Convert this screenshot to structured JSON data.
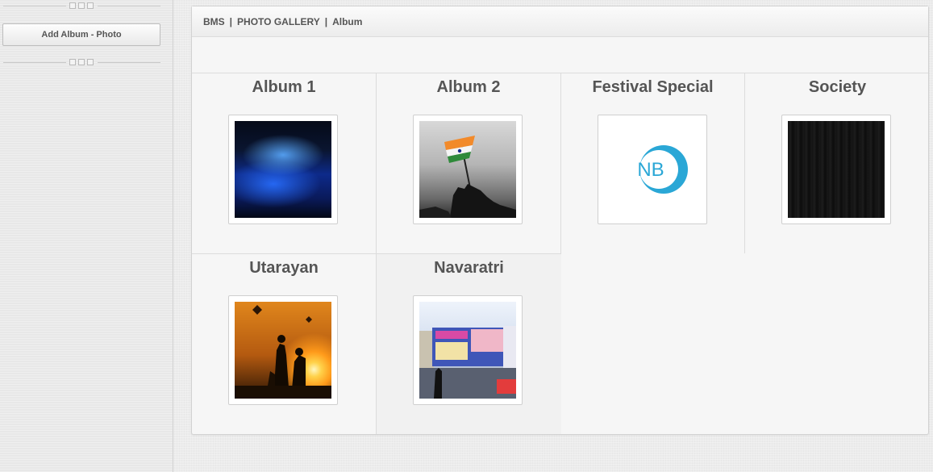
{
  "sidebar": {
    "add_button_label": "Add Album - Photo"
  },
  "breadcrumb": {
    "items": [
      "BMS",
      "PHOTO GALLERY",
      "Album"
    ],
    "separator": "|"
  },
  "albums": [
    {
      "title": "Album 1",
      "thumbnail": "bioluminescent-beach-photo"
    },
    {
      "title": "Album 2",
      "thumbnail": "flag-raising-photo"
    },
    {
      "title": "Festival Special",
      "thumbnail": "nb-logo"
    },
    {
      "title": "Society",
      "thumbnail": "dark-wood-texture"
    },
    {
      "title": "Utarayan",
      "thumbnail": "kite-festival-sunset-photo"
    },
    {
      "title": "Navaratri",
      "thumbnail": "navaratri-banner-photo"
    }
  ],
  "logo_text": "NB",
  "colors": {
    "logo_blue": "#2aa7d6",
    "text_gray": "#555555",
    "panel_bg": "#f6f6f6"
  }
}
